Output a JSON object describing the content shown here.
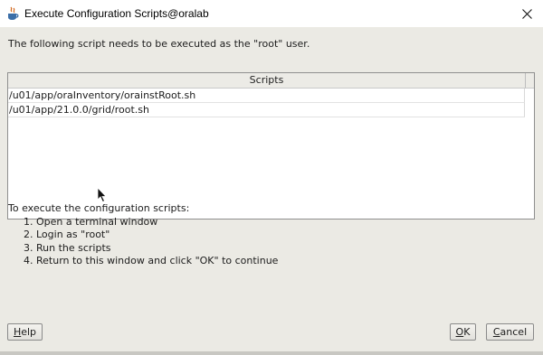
{
  "window": {
    "title": "Execute Configuration Scripts@oralab",
    "icons": {
      "app": "java-icon",
      "close": "close-icon"
    }
  },
  "intro_text": "The following script needs to be executed as the \"root\" user.",
  "table": {
    "header": "Scripts",
    "rows": [
      "/u01/app/oraInventory/orainstRoot.sh",
      "/u01/app/21.0.0/grid/root.sh"
    ]
  },
  "instructions": {
    "heading": "To execute the configuration scripts:",
    "steps": [
      "1. Open a terminal window",
      "2. Login as \"root\"",
      "3. Run the scripts",
      "4. Return to this window and click \"OK\" to continue"
    ]
  },
  "buttons": {
    "help": {
      "mnemonic": "H",
      "rest": "elp"
    },
    "ok": {
      "mnemonic": "O",
      "rest": "K"
    },
    "cancel": {
      "mnemonic": "C",
      "rest": "ancel"
    }
  }
}
